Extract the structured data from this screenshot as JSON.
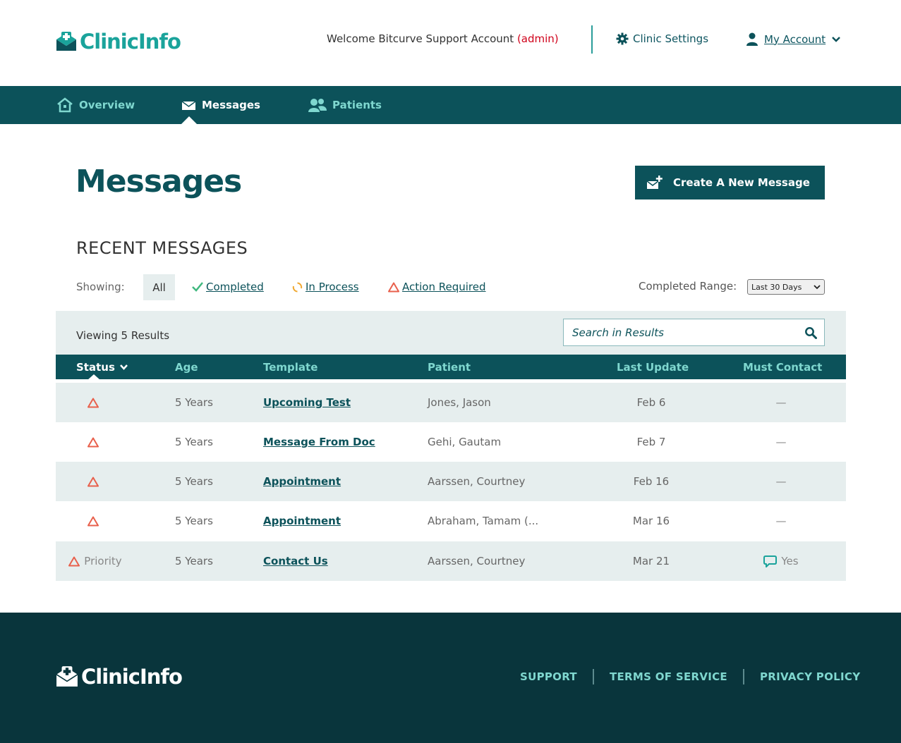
{
  "header": {
    "logo_text": "ClinicInfo",
    "welcome_prefix": "Welcome Bitcurve Support Account",
    "welcome_role": "(admin)",
    "settings_label": "Clinic Settings",
    "account_label": "My Account"
  },
  "nav": {
    "items": [
      {
        "label": "Overview",
        "icon": "home-icon"
      },
      {
        "label": "Messages",
        "icon": "envelope-icon",
        "active": true
      },
      {
        "label": "Patients",
        "icon": "users-icon"
      }
    ]
  },
  "page": {
    "title": "Messages",
    "create_button": "Create A New Message",
    "section_heading": "RECENT MESSAGES"
  },
  "filters": {
    "showing_label": "Showing:",
    "all": "All",
    "completed": "Completed",
    "in_process": "In Process",
    "action_required": "Action Required",
    "range_label": "Completed Range:",
    "range_value": "Last 30 Days"
  },
  "results": {
    "viewing_text": "Viewing 5 Results",
    "search_placeholder": "Search in Results"
  },
  "table": {
    "columns": [
      "Status",
      "Age",
      "Template",
      "Patient",
      "Last Update",
      "Must Contact"
    ],
    "rows": [
      {
        "status": "",
        "age": "5 Years",
        "template": "Upcoming Test",
        "patient": "Jones, Jason",
        "last_update": "Feb 6",
        "must_contact": "—"
      },
      {
        "status": "",
        "age": "5 Years",
        "template": "Message From Doc",
        "patient": "Gehi, Gautam",
        "last_update": "Feb 7",
        "must_contact": "—"
      },
      {
        "status": "",
        "age": "5 Years",
        "template": "Appointment",
        "patient": "Aarssen, Courtney",
        "last_update": "Feb 16",
        "must_contact": "—"
      },
      {
        "status": "",
        "age": "5 Years",
        "template": "Appointment",
        "patient": "Abraham, Tamam (...",
        "last_update": "Mar 16",
        "must_contact": "—"
      },
      {
        "status": "Priority",
        "age": "5 Years",
        "template": "Contact Us",
        "patient": "Aarssen, Courtney",
        "last_update": "Mar 21",
        "must_contact": "Yes"
      }
    ]
  },
  "footer": {
    "logo_text": "ClinicInfo",
    "links": [
      "SUPPORT",
      "TERMS OF SERVICE",
      "PRIVACY POLICY"
    ]
  },
  "colors": {
    "primary": "#0c525a",
    "accent": "#1aa39b",
    "light_teal": "#7fd7cf",
    "warning": "#e8604c",
    "row_alt": "#e6eeee",
    "footer_bg": "#09353c"
  }
}
